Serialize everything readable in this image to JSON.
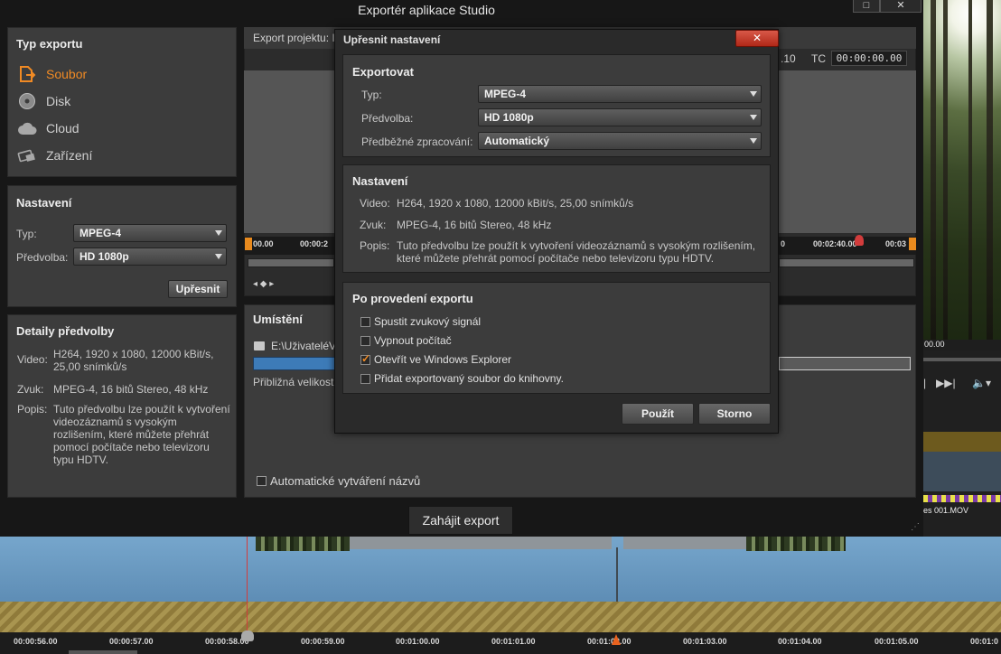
{
  "window": {
    "title": "Exportér aplikace Studio",
    "maximize_glyph": "□",
    "close_glyph": "✕"
  },
  "export_type_panel": {
    "title": "Typ exportu",
    "items": [
      {
        "label": "Soubor",
        "icon": "file-export-icon",
        "active": true
      },
      {
        "label": "Disk",
        "icon": "disc-icon",
        "active": false
      },
      {
        "label": "Cloud",
        "icon": "cloud-icon",
        "active": false
      },
      {
        "label": "Zařízení",
        "icon": "device-icon",
        "active": false
      }
    ]
  },
  "settings_panel": {
    "title": "Nastavení",
    "type_label": "Typ:",
    "type_value": "MPEG-4",
    "preset_label": "Předvolba:",
    "preset_value": "HD 1080p",
    "refine_button": "Upřesnit"
  },
  "preset_details": {
    "title": "Detaily předvolby",
    "video_label": "Video:",
    "video_value": "H264, 1920 x 1080, 12000 kBit/s, 25,00 snímků/s",
    "audio_label": "Zvuk:",
    "audio_value": "MPEG-4, 16 bitů Stereo, 48 kHz",
    "desc_label": "Popis:",
    "desc_value": "Tuto předvolbu lze použít k vytvoření videozáznamů s vysokým rozlišením, které můžete přehrát pomocí počítače nebo televizoru typu HDTV."
  },
  "preview": {
    "project_label": "Export projektu: I",
    "tc_frac": ".10",
    "tc_label": "TC",
    "tc_value": "00:00:00.00",
    "ruler_start": "00.00",
    "ruler_second": "00:00:2",
    "ruler_cut": "0",
    "ruler_mid": "00:02:40.00",
    "ruler_end": "00:03",
    "nav_glyph": "◂ ◆ ▸"
  },
  "location_panel": {
    "title": "Umístění",
    "path": "E:\\UživateléV",
    "size_label": "Přibližná velikost",
    "auto_naming_label": "Automatické vytváření názvů"
  },
  "start_export_button": "Zahájit export",
  "resize_grip": "⋰",
  "dialog": {
    "title": "Upřesnit nastavení",
    "close_glyph": "✕",
    "export_section": {
      "title": "Exportovat",
      "type_label": "Typ:",
      "type_value": "MPEG-4",
      "preset_label": "Předvolba:",
      "preset_value": "HD 1080p",
      "preprocess_label": "Předběžné zpracování:",
      "preprocess_value": "Automatický"
    },
    "settings_section": {
      "title": "Nastavení",
      "video_label": "Video:",
      "video_value": "H264, 1920 x 1080, 12000 kBit/s, 25,00 snímků/s",
      "audio_label": "Zvuk:",
      "audio_value": "MPEG-4, 16 bitů Stereo, 48 kHz",
      "desc_label": "Popis:",
      "desc_value": "Tuto předvolbu lze použít k vytvoření videozáznamů s vysokým rozlišením, které můžete přehrát pomocí počítače nebo televizoru typu HDTV."
    },
    "after_export_section": {
      "title": "Po provedení exportu",
      "options": [
        {
          "label": "Spustit zvukový signál",
          "checked": false
        },
        {
          "label": "Vypnout počítač",
          "checked": false
        },
        {
          "label": "Otevřít ve Windows Explorer",
          "checked": true
        },
        {
          "label": "Přidat exportovaný soubor do knihovny.",
          "checked": false
        }
      ]
    },
    "apply_button": "Použít",
    "cancel_button": "Storno"
  },
  "background_app": {
    "preview_time": "00.00",
    "clip_label": "es 001.MOV",
    "transport": {
      "skip_icon": "skip-forward-icon",
      "skip_glyph": "▶▶|",
      "volume_glyph": "🔈▾"
    }
  },
  "timeline": {
    "ticks": [
      "00:00:56.00",
      "00:00:57.00",
      "00:00:58.00",
      "00:00:59.00",
      "00:01:00.00",
      "00:01:01.00",
      "00:01:02.00",
      "00:01:03.00",
      "00:01:04.00",
      "00:01:05.00",
      "00:01:0"
    ]
  },
  "colors": {
    "accent": "#f08a24",
    "close_red": "#c8382a",
    "audio_track": "#6d9cc4"
  }
}
